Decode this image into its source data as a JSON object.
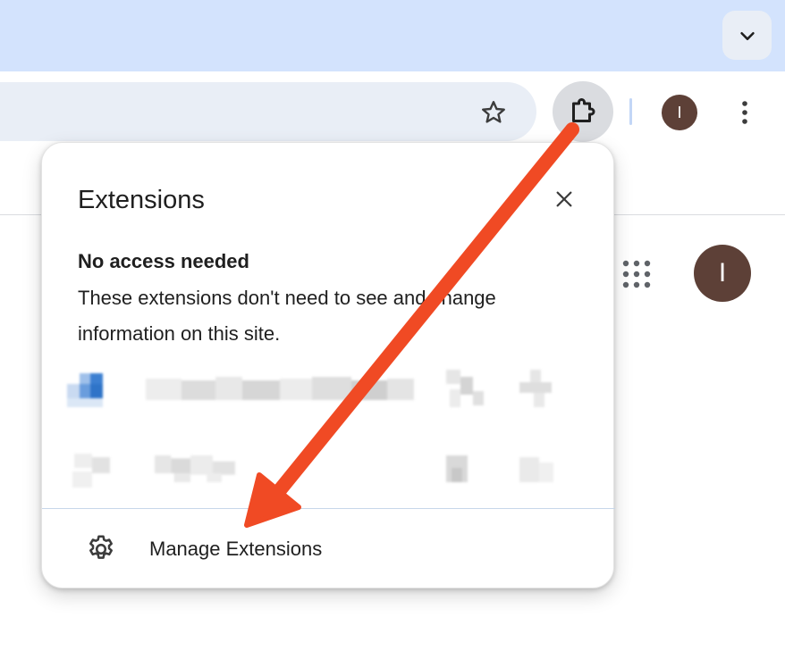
{
  "toolbar": {
    "profile_initial": "I",
    "icons": [
      "chevron-down-icon",
      "star-icon",
      "puzzle-icon",
      "more-vert-icon"
    ]
  },
  "page": {
    "avatar_initial": "I",
    "icons": [
      "apps-grid-icon"
    ]
  },
  "popup": {
    "title": "Extensions",
    "section_heading": "No access needed",
    "section_description": "These extensions don't need to see and change information on this site.",
    "manage_label": "Manage Extensions",
    "icons": [
      "close-icon",
      "gear-icon"
    ]
  },
  "colors": {
    "tab_strip": "#d3e3fd",
    "omnibox": "#e9eef6",
    "avatar": "#5d4037",
    "arrow": "#f04a24"
  }
}
